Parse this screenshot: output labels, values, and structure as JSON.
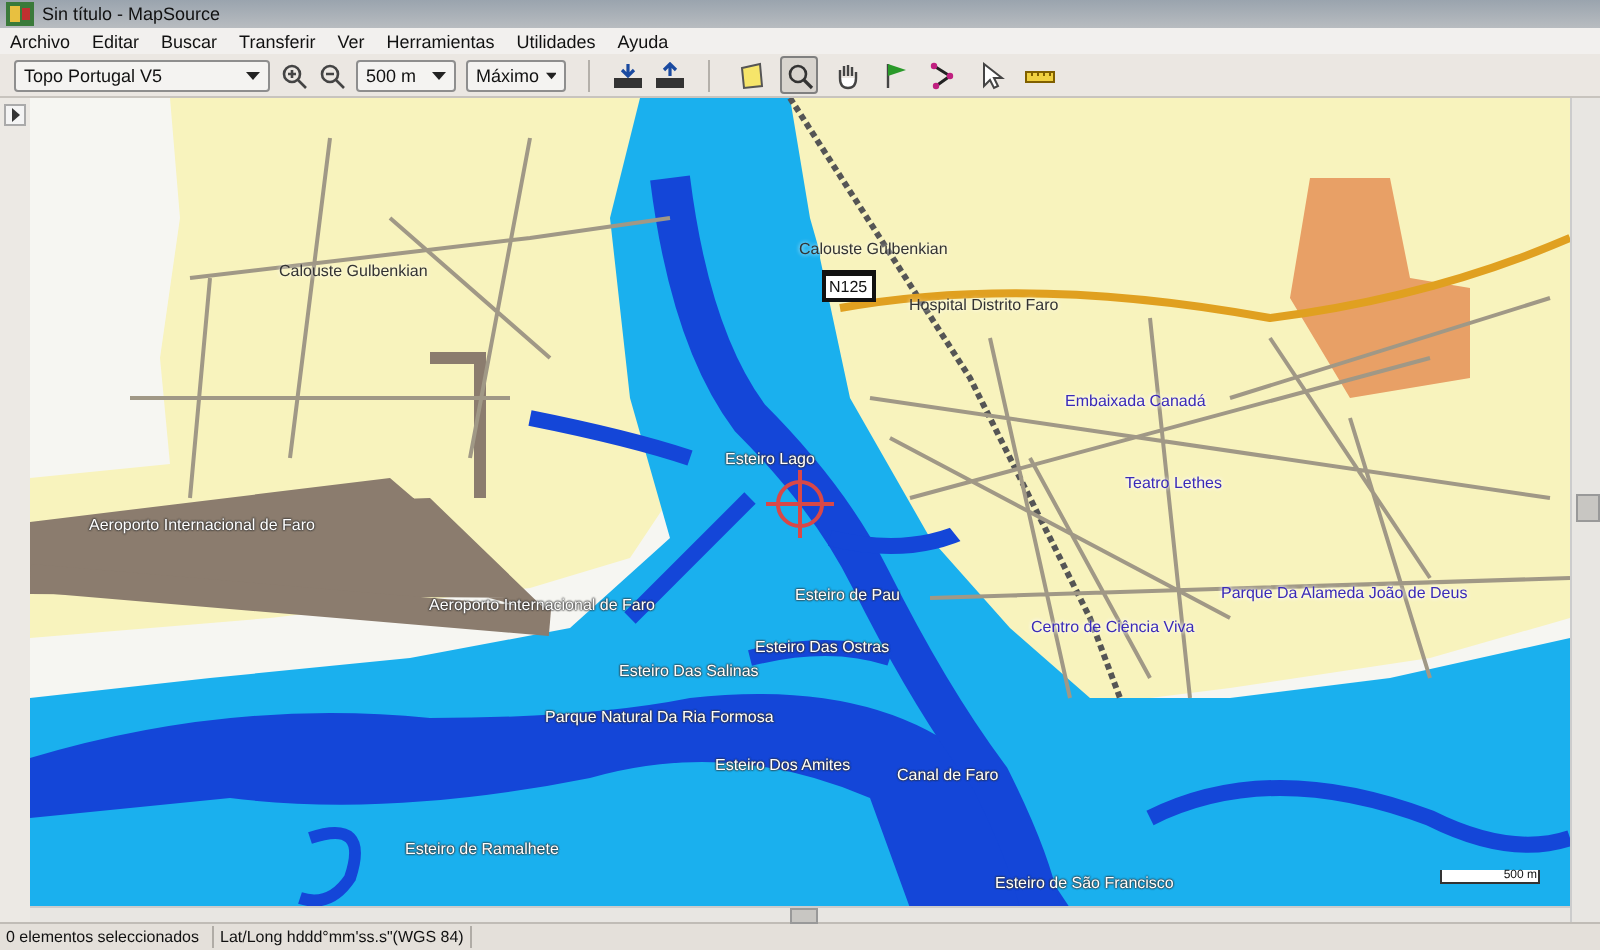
{
  "window": {
    "title": "Sin título - MapSource"
  },
  "menu": [
    "Archivo",
    "Editar",
    "Buscar",
    "Transferir",
    "Ver",
    "Herramientas",
    "Utilidades",
    "Ayuda"
  ],
  "toolbar": {
    "map_product": "Topo Portugal V5",
    "zoom_scale": "500 m",
    "detail": "Máximo",
    "tools": [
      {
        "kind": "map-select",
        "selected": false
      },
      {
        "kind": "zoom",
        "selected": true
      },
      {
        "kind": "hand",
        "selected": false
      },
      {
        "kind": "waypoint",
        "selected": false
      },
      {
        "kind": "route",
        "selected": false
      },
      {
        "kind": "pointer",
        "selected": false
      },
      {
        "kind": "measure",
        "selected": false
      }
    ]
  },
  "map": {
    "road_shield": "N125",
    "scale": "500 m",
    "labels": [
      {
        "text": "Aeroporto Internacional de Faro",
        "kind": "water"
      },
      {
        "text": "Aeroporto Internacional de Faro",
        "kind": "water"
      },
      {
        "text": "Esteiro Lago",
        "kind": "water"
      },
      {
        "text": "Esteiro de Pau",
        "kind": "water"
      },
      {
        "text": "Esteiro Das Ostras",
        "kind": "water"
      },
      {
        "text": "Esteiro Das Salinas",
        "kind": "water"
      },
      {
        "text": "Parque Natural Da Ria Formosa",
        "kind": "water"
      },
      {
        "text": "Esteiro Dos Amites",
        "kind": "water"
      },
      {
        "text": "Canal de Faro",
        "kind": "water"
      },
      {
        "text": "Esteiro de Ramalhete",
        "kind": "water"
      },
      {
        "text": "Esteiro de São Francisco",
        "kind": "water"
      },
      {
        "text": "Calouste Gulbenkian",
        "kind": "street"
      },
      {
        "text": "Calouste Gulbenkian",
        "kind": "street"
      },
      {
        "text": "Hospital Distrito Faro",
        "kind": "street"
      },
      {
        "text": "Embaixada Canadá",
        "kind": "place"
      },
      {
        "text": "Teatro Lethes",
        "kind": "place"
      },
      {
        "text": "Parque Da Alameda João de Deus",
        "kind": "place"
      },
      {
        "text": "Centro de Ciência Viva",
        "kind": "place"
      }
    ]
  },
  "status_bar": {
    "selection": "0 elementos seleccionados",
    "position_format": "Lat/Long hddd°mm'ss.s\"(WGS 84)"
  }
}
